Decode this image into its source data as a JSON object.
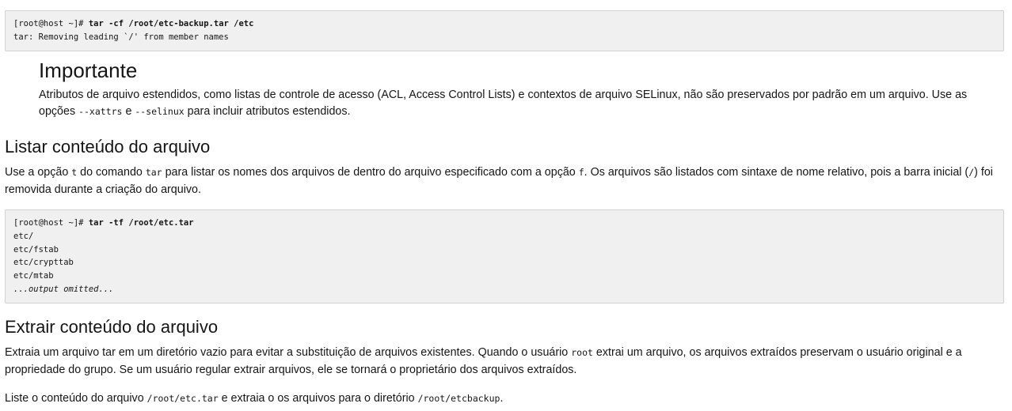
{
  "code_block_1": {
    "prompt": "[root@host ~]# ",
    "command": "tar -cf /root/etc-backup.tar /etc",
    "output": "tar: Removing leading `/' from member names"
  },
  "important": {
    "title": "Importante",
    "text_1": "Atributos de arquivo estendidos, como listas de controle de acesso (ACL, Access Control Lists) e contextos de arquivo SELinux, não são preservados por padrão em um arquivo. Use as opções ",
    "code_1": "--xattrs",
    "text_2": " e ",
    "code_2": "--selinux",
    "text_3": " para incluir atributos estendidos."
  },
  "section_list": {
    "heading": "Listar conteúdo do arquivo",
    "p_1": "Use a opção ",
    "c_1": "t",
    "p_2": " do comando ",
    "c_2": "tar",
    "p_3": " para listar os nomes dos arquivos de dentro do arquivo especificado com a opção ",
    "c_3": "f",
    "p_4": ". Os arquivos são listados com sintaxe de nome relativo, pois a barra inicial (",
    "c_4": "/",
    "p_5": ") foi removida durante a criação do arquivo."
  },
  "code_block_2": {
    "prompt": "[root@host ~]# ",
    "command": "tar -tf /root/etc.tar",
    "lines": [
      "etc/",
      "etc/fstab",
      "etc/crypttab",
      "etc/mtab"
    ],
    "omitted": "...output omitted..."
  },
  "section_extract": {
    "heading": "Extrair conteúdo do arquivo",
    "p_1": "Extraia um arquivo tar em um diretório vazio para evitar a substituição de arquivos existentes. Quando o usuário ",
    "c_1": "root",
    "p_2": " extrai um arquivo, os arquivos extraídos preservam o usuário original e a propriedade do grupo. Se um usuário regular extrair arquivos, ele se tornará o proprietário dos arquivos extraídos."
  },
  "section_liste": {
    "p_1": "Liste o conteúdo do arquivo ",
    "c_1": "/root/etc.tar",
    "p_2": " e extraia o os arquivos para o diretório ",
    "c_2": "/root/etcbackup",
    "p_3": "."
  }
}
